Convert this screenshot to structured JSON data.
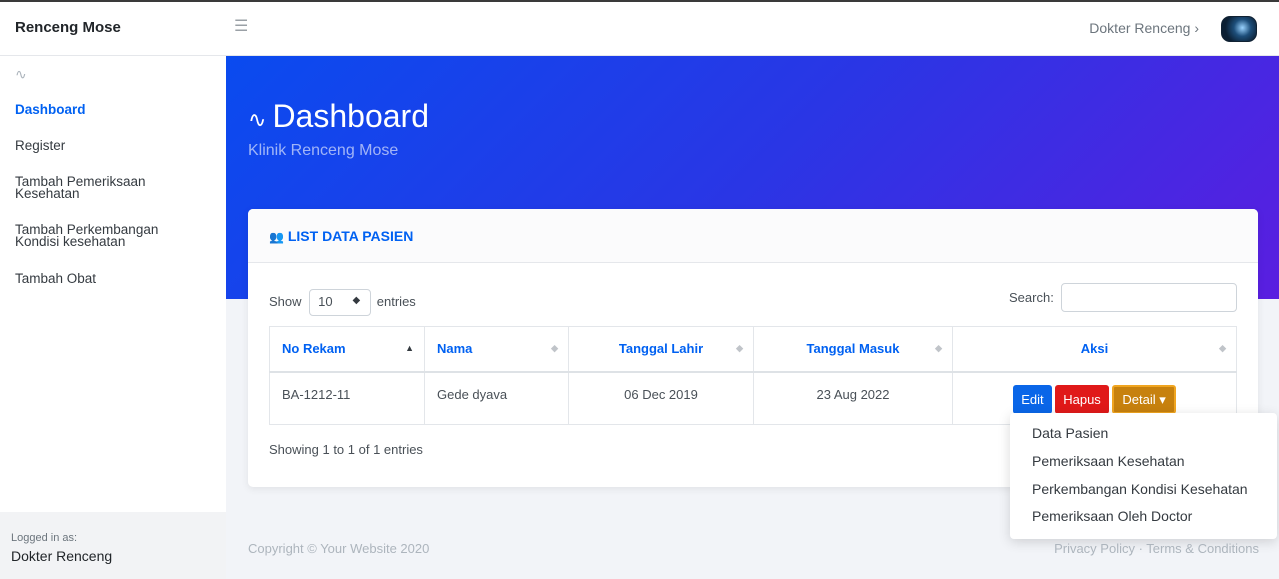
{
  "topbar": {
    "brand": "Renceng Mose",
    "menu_icon": "☰",
    "user_label": "Dokter Renceng ›"
  },
  "sidebar": {
    "pulse_icon": "∿",
    "items": [
      {
        "label": "Dashboard",
        "active": true
      },
      {
        "label": "Register"
      },
      {
        "label": "Tambah Pemeriksaan\nKesehatan"
      },
      {
        "label": "Tambah Perkembangan\nKondisi kesehatan"
      },
      {
        "label": "Tambah Obat"
      }
    ],
    "logged_in_label": "Logged in as:",
    "logged_in_name": "Dokter Renceng"
  },
  "header": {
    "title": "Dashboard",
    "pulse_icon": "∿",
    "subtitle": "Klinik Renceng Mose"
  },
  "card": {
    "title": "LIST DATA PASIEN",
    "users_icon": "👥",
    "show_label": "Show",
    "entries_value": "10",
    "entries_label": "entries",
    "search_label": "Search:",
    "columns": [
      "No Rekam",
      "Nama",
      "Tanggal Lahir",
      "Tanggal Masuk",
      "Aksi"
    ],
    "rows": [
      {
        "no_rekam": "BA-1212-11",
        "nama": "Gede dyava",
        "tanggal_lahir": "06 Dec 2019",
        "tanggal_masuk": "23 Aug 2022"
      }
    ],
    "actions": {
      "edit": "Edit",
      "hapus": "Hapus",
      "detail": "Detail ▾"
    },
    "info": "Showing 1 to 1 of 1 entries"
  },
  "dropdown": {
    "items": [
      "Data Pasien",
      "Pemeriksaan Kesehatan",
      "Perkembangan Kondisi Kesehatan",
      "Pemeriksaan Oleh Doctor"
    ]
  },
  "footer": {
    "copyright": "Copyright © Your Website 2020",
    "links": "Privacy Policy · Terms & Conditions"
  },
  "colors": {
    "primary": "#0061f2",
    "edit": "#0a66e8",
    "hapus": "#e01919",
    "detail": "#c7810e"
  }
}
